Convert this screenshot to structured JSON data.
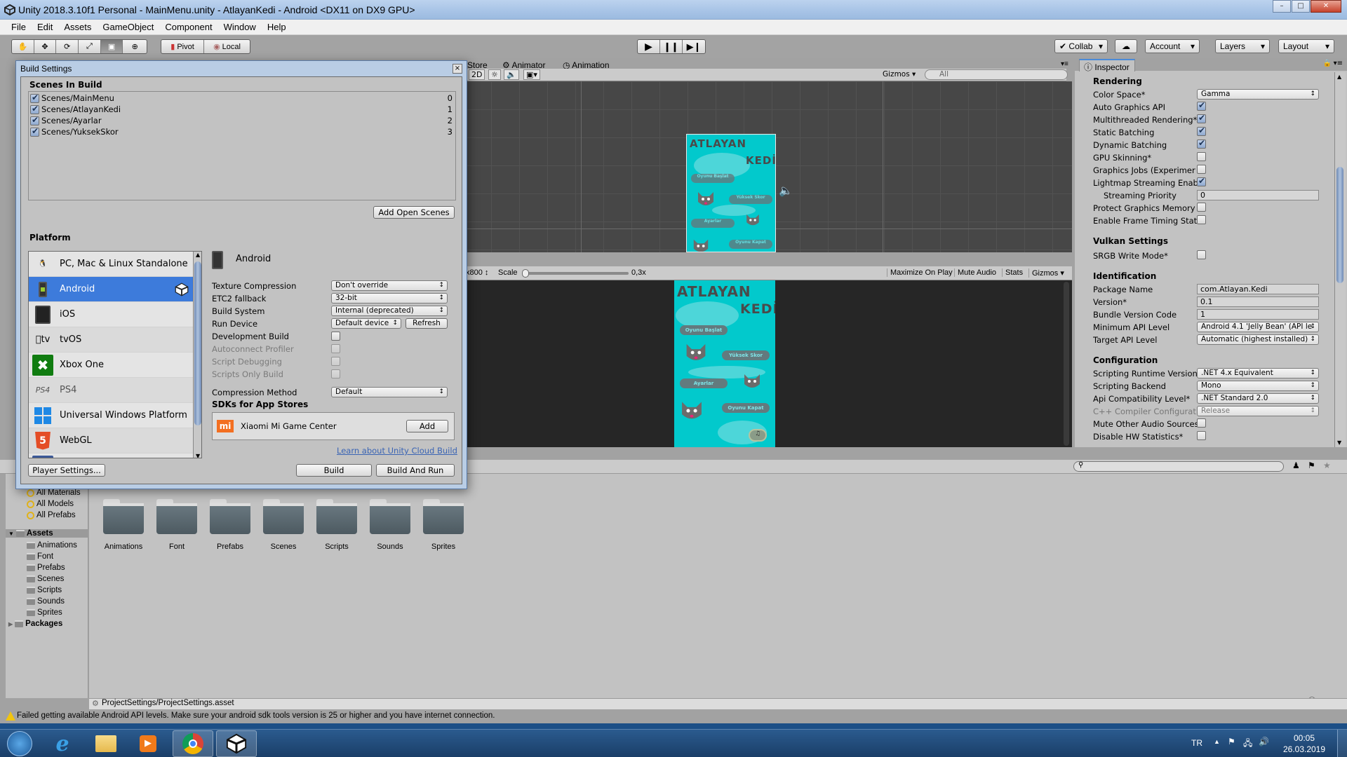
{
  "window": {
    "title": "Unity 2018.3.10f1 Personal - MainMenu.unity - AtlayanKedi - Android <DX11 on DX9 GPU>",
    "controls": [
      "minimize",
      "maximize",
      "close"
    ]
  },
  "menu": [
    "File",
    "Edit",
    "Assets",
    "GameObject",
    "Component",
    "Window",
    "Help"
  ],
  "toolbar": {
    "tools": [
      "hand-tool",
      "move-tool",
      "rotate-tool",
      "scale-tool",
      "rect-tool",
      "transform-tool"
    ],
    "active_tool": "rect-tool",
    "pivot_label": "Pivot",
    "local_label": "Local",
    "collab_label": "Collab",
    "account_label": "Account",
    "layers_label": "Layers",
    "layout_label": "Layout"
  },
  "scene_panel": {
    "tabs": [
      "Store",
      "Animator",
      "Animation"
    ],
    "mode_2d": "2D",
    "gizmos_label": "Gizmos",
    "search_placeholder": "All"
  },
  "game_panel": {
    "resolution_suffix": "x800",
    "scale_label": "Scale",
    "scale_value": "0,3x",
    "scale_fraction": 0.0,
    "buttons": [
      "Maximize On Play",
      "Mute Audio",
      "Stats",
      "Gizmos"
    ]
  },
  "game_art": {
    "title_line1": "ATLAYAN",
    "title_line2": "KEDİ",
    "menu_buttons": [
      "Oyunu Başlat",
      "Yüksek Skor",
      "Ayarlar",
      "Oyunu Kapat"
    ],
    "bg_color": "#02c9cc"
  },
  "build_settings": {
    "title": "Build Settings",
    "scenes_header": "Scenes In Build",
    "scenes": [
      {
        "name": "Scenes/MainMenu",
        "index": "0",
        "checked": true
      },
      {
        "name": "Scenes/AtlayanKedi",
        "index": "1",
        "checked": true
      },
      {
        "name": "Scenes/Ayarlar",
        "index": "2",
        "checked": true
      },
      {
        "name": "Scenes/YuksekSkor",
        "index": "3",
        "checked": true
      }
    ],
    "add_open_scenes": "Add Open Scenes",
    "platform_header": "Platform",
    "platforms": [
      {
        "name": "PC, Mac & Linux Standalone",
        "icon": "standalone-icon",
        "selected": false
      },
      {
        "name": "Android",
        "icon": "android-icon",
        "selected": true
      },
      {
        "name": "iOS",
        "icon": "ios-icon",
        "selected": false
      },
      {
        "name": "tvOS",
        "icon": "tvos-icon",
        "selected": false
      },
      {
        "name": "Xbox One",
        "icon": "xbox-icon",
        "selected": false
      },
      {
        "name": "PS4",
        "icon": "ps4-icon",
        "selected": false
      },
      {
        "name": "Universal Windows Platform",
        "icon": "windows-icon",
        "selected": false
      },
      {
        "name": "WebGL",
        "icon": "html5-icon",
        "selected": false
      }
    ],
    "selected_platform": "Android",
    "options": {
      "texture_compression": {
        "label": "Texture Compression",
        "value": "Don't override"
      },
      "etc2_fallback": {
        "label": "ETC2 fallback",
        "value": "32-bit"
      },
      "build_system": {
        "label": "Build System",
        "value": "Internal (deprecated)"
      },
      "run_device": {
        "label": "Run Device",
        "value": "Default device",
        "refresh": "Refresh"
      },
      "development_build": {
        "label": "Development Build",
        "checked": false
      },
      "autoconnect_profiler": {
        "label": "Autoconnect Profiler",
        "checked": false
      },
      "script_debugging": {
        "label": "Script Debugging",
        "checked": false
      },
      "scripts_only_build": {
        "label": "Scripts Only Build",
        "checked": false
      },
      "compression_method": {
        "label": "Compression Method",
        "value": "Default"
      }
    },
    "sdks_header": "SDKs for App Stores",
    "sdk_name": "Xiaomi Mi Game Center",
    "sdk_add": "Add",
    "cloud_build_link": "Learn about Unity Cloud Build",
    "player_settings": "Player Settings...",
    "build": "Build",
    "build_and_run": "Build And Run"
  },
  "inspector": {
    "tab": "Inspector",
    "sections": {
      "rendering": "Rendering",
      "vulkan": "Vulkan Settings",
      "identification": "Identification",
      "configuration": "Configuration"
    },
    "rendering": {
      "color_space": {
        "label": "Color Space*",
        "value": "Gamma"
      },
      "auto_graphics_api": {
        "label": "Auto Graphics API",
        "checked": true
      },
      "multithreaded_rendering": {
        "label": "Multithreaded Rendering*",
        "checked": true
      },
      "static_batching": {
        "label": "Static Batching",
        "checked": true
      },
      "dynamic_batching": {
        "label": "Dynamic Batching",
        "checked": true
      },
      "gpu_skinning": {
        "label": "GPU Skinning*",
        "checked": false
      },
      "graphics_jobs": {
        "label": "Graphics Jobs (Experimer",
        "checked": false
      },
      "lightmap_streaming": {
        "label": "Lightmap Streaming Enab",
        "checked": true
      },
      "streaming_priority": {
        "label": "Streaming Priority",
        "value": "0"
      },
      "protect_graphics_memory": {
        "label": "Protect Graphics Memory",
        "checked": false
      },
      "frame_timing_stats": {
        "label": "Enable Frame Timing Stat",
        "checked": false
      }
    },
    "vulkan": {
      "srgb_write_mode": {
        "label": "SRGB Write Mode*",
        "checked": false
      }
    },
    "identification": {
      "package_name": {
        "label": "Package Name",
        "value": "com.Atlayan.Kedi"
      },
      "version": {
        "label": "Version*",
        "value": "0.1"
      },
      "bundle_version_code": {
        "label": "Bundle Version Code",
        "value": "1"
      },
      "min_api_level": {
        "label": "Minimum API Level",
        "value": "Android 4.1 'Jelly Bean' (API le"
      },
      "target_api_level": {
        "label": "Target API Level",
        "value": "Automatic (highest installed)"
      }
    },
    "configuration": {
      "scripting_runtime": {
        "label": "Scripting Runtime Version",
        "value": ".NET 4.x Equivalent"
      },
      "scripting_backend": {
        "label": "Scripting Backend",
        "value": "Mono"
      },
      "api_compat": {
        "label": "Api Compatibility Level*",
        "value": ".NET Standard 2.0"
      },
      "cpp_compiler": {
        "label": "C++ Compiler Configurat",
        "value": "Release"
      },
      "mute_audio": {
        "label": "Mute Other Audio Sources",
        "checked": false
      },
      "disable_hw_stats": {
        "label": "Disable HW Statistics*",
        "checked": false
      }
    }
  },
  "project": {
    "favorites": [
      "All Materials",
      "All Models",
      "All Prefabs"
    ],
    "assets_root": "Assets",
    "asset_folders": [
      "Animations",
      "Font",
      "Prefabs",
      "Scenes",
      "Scripts",
      "Sounds",
      "Sprites"
    ],
    "packages_root": "Packages",
    "grid_folders": [
      "Animations",
      "Font",
      "Prefabs",
      "Scenes",
      "Scripts",
      "Sounds",
      "Sprites"
    ],
    "selected_path": "ProjectSettings/ProjectSettings.asset"
  },
  "status": {
    "message": "Failed getting available Android API levels. Make sure your android sdk tools version is 25 or higher and you have internet connection."
  },
  "taskbar": {
    "apps": [
      "start",
      "internet-explorer",
      "file-explorer",
      "media-player",
      "chrome",
      "unity"
    ],
    "language": "TR",
    "time": "00:05",
    "date": "26.03.2019"
  }
}
